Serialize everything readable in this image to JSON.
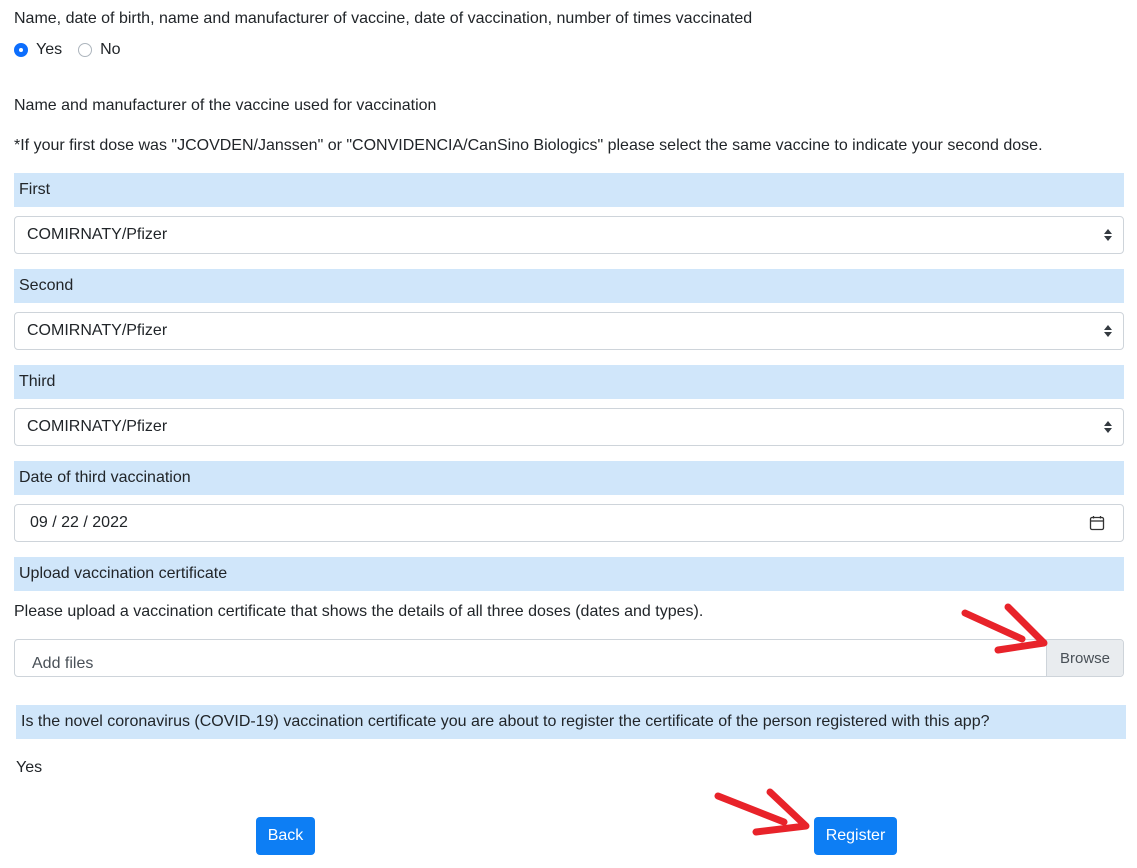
{
  "personal_info": {
    "question": "Name, date of birth, name and manufacturer of vaccine, date of vaccination, number of times vaccinated",
    "options": [
      {
        "label": "Yes",
        "selected": true
      },
      {
        "label": "No",
        "selected": false
      }
    ]
  },
  "vaccine_section": {
    "title": "Name and manufacturer of the vaccine used for vaccination",
    "note": "*If your first dose was \"JCOVDEN/Janssen\" or \"CONVIDENCIA/CanSino Biologics\" please select the same vaccine to indicate your second dose.",
    "doses": [
      {
        "label": "First",
        "value": "COMIRNATY/Pfizer"
      },
      {
        "label": "Second",
        "value": "COMIRNATY/Pfizer"
      },
      {
        "label": "Third",
        "value": "COMIRNATY/Pfizer"
      }
    ]
  },
  "date_section": {
    "label": "Date of third vaccination",
    "value": "09 / 22 / 2022"
  },
  "upload_section": {
    "label": "Upload vaccination certificate",
    "instruction": "Please upload a vaccination certificate that shows the details of all three doses (dates and types).",
    "placeholder": "Add files",
    "browse_label": "Browse"
  },
  "confirm_section": {
    "question": "Is the novel coronavirus (COVID-19) vaccination certificate you are about to register the certificate of the person registered with this app?",
    "answer": "Yes"
  },
  "actions": {
    "back_label": "Back",
    "register_label": "Register"
  },
  "colors": {
    "band": "#d0e6fa",
    "primary": "#0d7ef4",
    "annotation_arrow": "#e8232a"
  }
}
